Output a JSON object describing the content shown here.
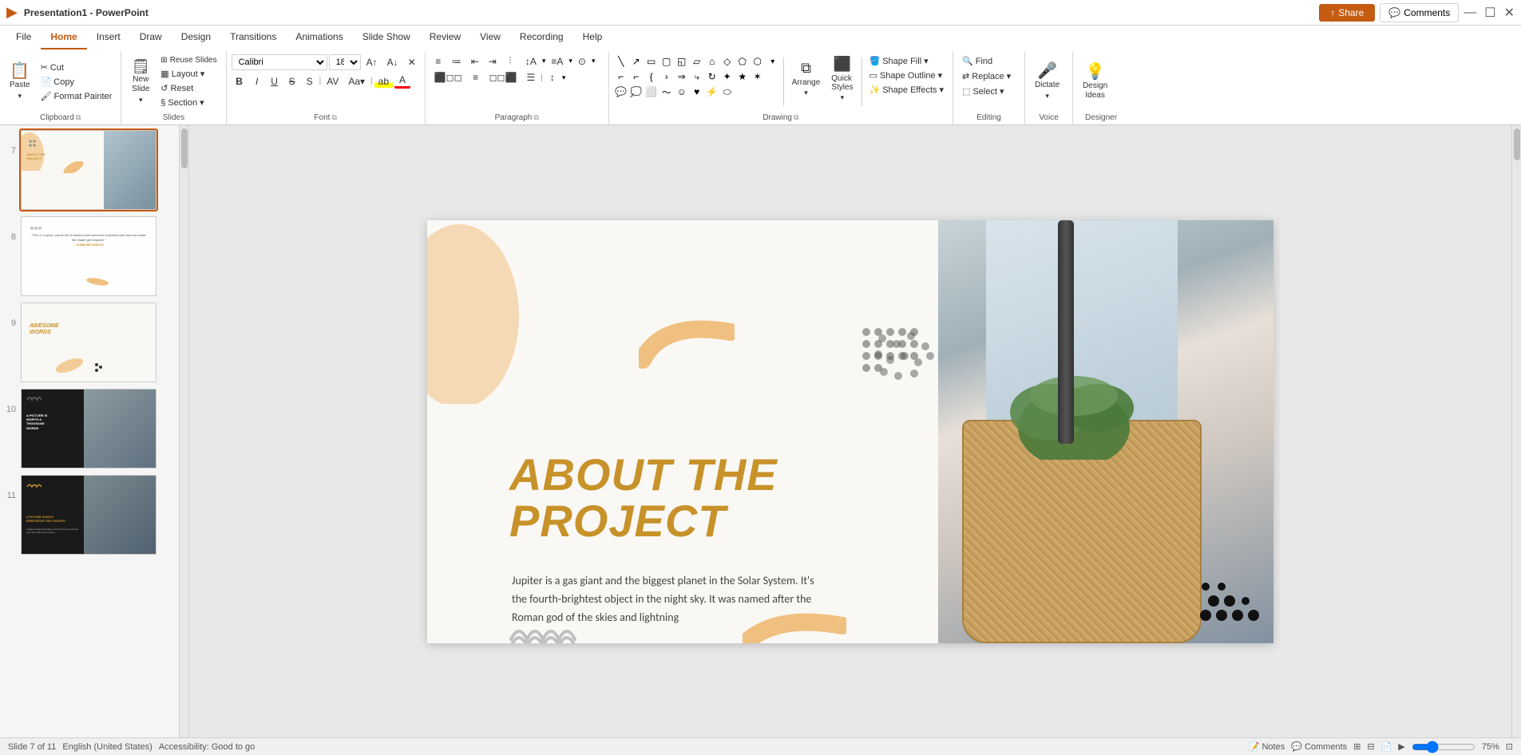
{
  "app": {
    "title": "PowerPoint",
    "document_name": "Presentation1 - PowerPoint"
  },
  "title_bar": {
    "share_label": "Share",
    "comments_label": "Comments"
  },
  "ribbon": {
    "tabs": [
      {
        "id": "file",
        "label": "File"
      },
      {
        "id": "home",
        "label": "Home",
        "active": true
      },
      {
        "id": "insert",
        "label": "Insert"
      },
      {
        "id": "draw",
        "label": "Draw"
      },
      {
        "id": "design",
        "label": "Design"
      },
      {
        "id": "transitions",
        "label": "Transitions"
      },
      {
        "id": "animations",
        "label": "Animations"
      },
      {
        "id": "slideshow",
        "label": "Slide Show"
      },
      {
        "id": "review",
        "label": "Review"
      },
      {
        "id": "view",
        "label": "View"
      },
      {
        "id": "recording",
        "label": "Recording"
      },
      {
        "id": "help",
        "label": "Help"
      }
    ],
    "groups": {
      "clipboard": {
        "label": "Clipboard",
        "paste": "Paste",
        "cut": "Cut",
        "copy": "Copy",
        "format_painter": "Format Painter"
      },
      "slides": {
        "label": "Slides",
        "new_slide": "New Slide",
        "layout": "Layout",
        "reset": "Reset",
        "section": "Section"
      },
      "font": {
        "label": "Font",
        "font_name": "Calibri",
        "font_size": "18",
        "bold": "B",
        "italic": "I",
        "underline": "U",
        "strikethrough": "S",
        "shadow": "S",
        "char_spacing": "AV",
        "font_color": "A",
        "highlight": "ab"
      },
      "paragraph": {
        "label": "Paragraph",
        "bullets": "Bullets",
        "numbering": "Numbering",
        "decrease_indent": "Decrease",
        "increase_indent": "Increase",
        "columns": "Columns",
        "text_direction": "Text Direction",
        "align_text": "Align Text",
        "convert_smartart": "Convert to SmartArt",
        "align_left": "Left",
        "center": "Center",
        "align_right": "Right",
        "justify": "Justify",
        "line_spacing": "Line Spacing"
      },
      "drawing": {
        "label": "Drawing",
        "arrange": "Arrange",
        "quick_styles": "Quick Styles",
        "shape_fill": "Shape Fill",
        "shape_outline": "Shape Outline",
        "shape_effects": "Shape Effects"
      },
      "editing": {
        "label": "Editing",
        "find": "Find",
        "replace": "Replace",
        "select": "Select"
      },
      "voice": {
        "label": "Voice",
        "dictate": "Dictate"
      },
      "designer": {
        "label": "Designer",
        "design_ideas": "Design Ideas"
      }
    }
  },
  "slides": [
    {
      "num": 7,
      "active": true,
      "mini_title": "ABOUT THE\nPROJECT",
      "has_photo": true
    },
    {
      "num": 8,
      "active": false,
      "mini_quote": "\"This is a quote, words full of wisdom that someone important said and can make the reader get inspired.\"",
      "mini_attribution": "—SOMEONE FAMOUS"
    },
    {
      "num": 9,
      "active": false,
      "mini_title": "AWESOME WORDS"
    },
    {
      "num": 10,
      "active": false,
      "mini_title": "A PICTURE IS WORTH A THOUSAND WORDS",
      "dark": true
    },
    {
      "num": 11,
      "active": false,
      "mini_title": "A PICTURE ALWAYS REINFORCES THE CONCEPT",
      "dark": true
    }
  ],
  "main_slide": {
    "title_line1": "ABOUT THE",
    "title_line2": "PROJECT",
    "body_text": "Jupiter is a gas giant and the biggest planet in the Solar System. It's the fourth-brightest object in the night sky. It was named after the Roman god of the skies and lightning",
    "accent_color": "#c8922a"
  },
  "status_bar": {
    "slide_info": "Slide 7 of 11",
    "language": "English (United States)",
    "accessibility": "Accessibility: Good to go",
    "zoom_level": "75%"
  }
}
